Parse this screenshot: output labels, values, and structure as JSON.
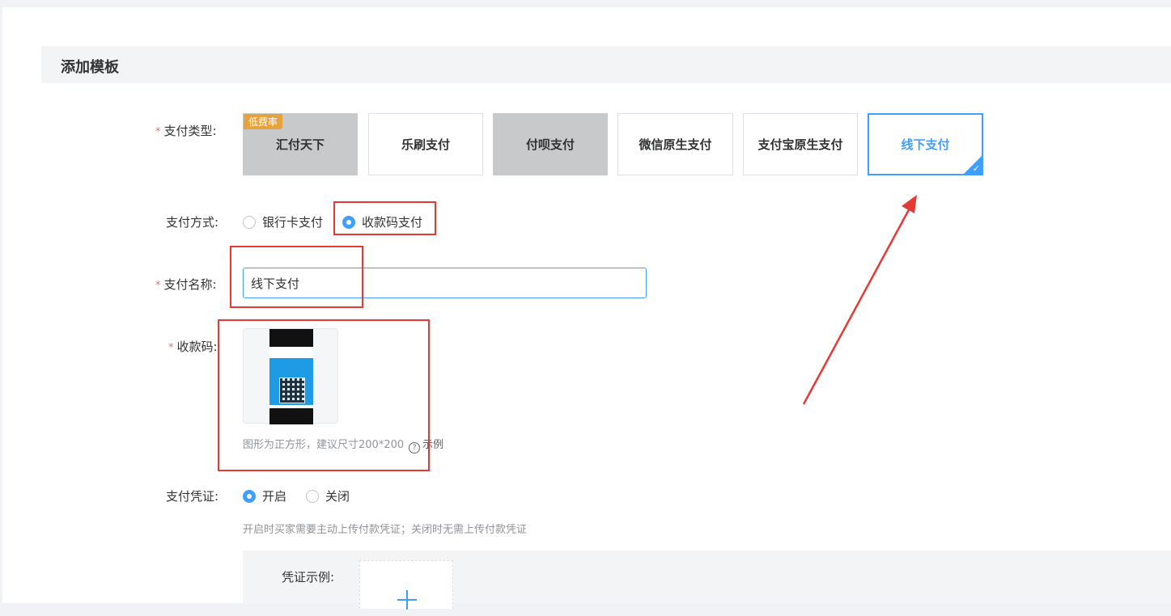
{
  "section": {
    "title": "添加模板"
  },
  "pay_type": {
    "label": "支付类型:",
    "badge": "低费率",
    "options": [
      {
        "label": "汇付天下",
        "state": "disabled"
      },
      {
        "label": "乐刷支付",
        "state": "normal"
      },
      {
        "label": "付呗支付",
        "state": "disabled"
      },
      {
        "label": "微信原生支付",
        "state": "normal"
      },
      {
        "label": "支付宝原生支付",
        "state": "normal"
      },
      {
        "label": "线下支付",
        "state": "selected"
      }
    ]
  },
  "pay_method": {
    "label": "支付方式:",
    "options": [
      {
        "label": "银行卡支付",
        "checked": false
      },
      {
        "label": "收款码支付",
        "checked": true
      }
    ]
  },
  "pay_name": {
    "label": "支付名称:",
    "value": "线下支付"
  },
  "qr_code": {
    "label": "收款码:",
    "hint": "图形为正方形，建议尺寸200*200",
    "example": "示例"
  },
  "voucher": {
    "label": "支付凭证:",
    "options": [
      {
        "label": "开启",
        "checked": true
      },
      {
        "label": "关闭",
        "checked": false
      }
    ],
    "hint": "开启时买家需要主动上传付款凭证；关闭时无需上传付款凭证",
    "sample_label": "凭证示例:"
  },
  "colors": {
    "accent": "#409eff",
    "required": "#f56c6c",
    "badge": "#e6a23c",
    "annotation": "#e53935"
  }
}
